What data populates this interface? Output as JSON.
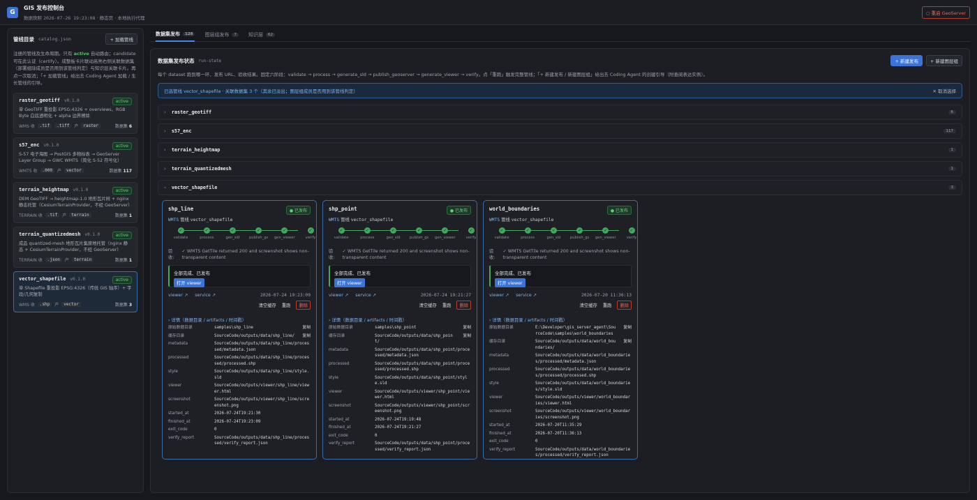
{
  "header": {
    "logo": "G",
    "title": "GIS 发布控制台",
    "subtitle_prefix": "数据快照",
    "snapshot_time": "2026-07-26 19:23:08",
    "subtitle_suffix": "· 静态页 · 本地执行代理",
    "restart": "○ 重启 GeoServer"
  },
  "sidebar": {
    "title": "管线目录",
    "file": "catalog.json",
    "add": "+ 加载管线",
    "desc_1": "注册的管线及生命周期。只有",
    "desc_active": "active",
    "desc_2": "自动路由；candidate 可在此认证（certify）。成整板卡片联动高亮右侧关联数据集（部署组除成员是否用到该管线判定）与知识层关联卡片。再点一次取消；「+ 加载管线」给出去 Coding Agent 加载 / 生长管线的引导。",
    "items": [
      {
        "name": "raster_geotiff",
        "version": "v0.1.0",
        "status": "active",
        "desc": "单 GeoTIFF 重投影 EPSG:4326 + overviews、RGB Byte 白底透明化 + alpha 边界擦除",
        "kind": "WMS 收",
        "ext1": ".tif",
        "ext2": ".tiff",
        "out_lbl": "产",
        "out": "raster",
        "count_lbl": "数据集",
        "count": "6"
      },
      {
        "name": "s57_enc",
        "version": "v0.1.0",
        "status": "active",
        "desc": "S-57 电子海图 → PostGIS 多物标表 → GeoServer Layer Group → GWC WMTS（简化 S-52 符号化）",
        "kind": "WMTS 收",
        "ext1": ".000",
        "ext2": "",
        "out_lbl": "产",
        "out": "vector",
        "count_lbl": "数据集",
        "count": "117"
      },
      {
        "name": "terrain_heightmap",
        "version": "v0.1.0",
        "status": "active",
        "desc": "DEM GeoTIFF → heightmap-1.0 地形瓦片树 + nginx 静态托管（CesiumTerrainProvider，不经 GeoServer）",
        "kind": "TERRAIN 收",
        "ext1": ".tif",
        "ext2": "",
        "out_lbl": "产",
        "out": "terrain",
        "count_lbl": "数据集",
        "count": "1"
      },
      {
        "name": "terrain_quantizedmesh",
        "version": "v0.1.0",
        "status": "active",
        "desc": "成品 quantized-mesh 地形瓦片集原地托管（nginx 静态 + CesiumTerrainProvider，不经 GeoServer）",
        "kind": "TERRAIN 收",
        "ext1": ".json",
        "ext2": "",
        "out_lbl": "产",
        "out": "terrain",
        "count_lbl": "数据集",
        "count": "1"
      },
      {
        "name": "vector_shapefile",
        "version": "v0.1.0",
        "status": "active",
        "desc": "单 Shapefile 重投影 EPSG:4326（传统 GIS 轴序）+ 字段/几何复制",
        "kind": "WMS 收",
        "ext1": ".shp",
        "ext2": "",
        "out_lbl": "产",
        "out": "vector",
        "count_lbl": "数据集",
        "count": "3"
      }
    ]
  },
  "tabs": [
    {
      "label": "数据集发布",
      "count": "128"
    },
    {
      "label": "图层组发布",
      "count": "7"
    },
    {
      "label": "知识层",
      "count": "62"
    }
  ],
  "panel": {
    "title": "数据集发布状态",
    "sub": "run-state",
    "btn_new": "+ 新建发布",
    "btn_group": "+ 新建图层组",
    "desc": "每个 dataset 跑到哪一环、发布 URL、验收结果。固定六阶段：validate → process → generate_sld → publish_geoserver → generate_viewer → verify。点「重跑」触发完整管线；「+ 新建发布 / 新建图层组」给出去 Coding Agent 的创建引导（附查阅表达实例）。",
    "alert": "已选管线 vector_shapefile · 关联数据集 3 个（其余已淡出；图层组成员是否用到该管线判定）",
    "cancel": "✕ 取消选择"
  },
  "datasets": [
    {
      "name": "raster_geotiff",
      "count": "6"
    },
    {
      "name": "s57_enc",
      "count": "117"
    },
    {
      "name": "terrain_heightmap",
      "count": "1"
    },
    {
      "name": "terrain_quantizedmesh",
      "count": "1"
    },
    {
      "name": "vector_shapefile",
      "count": "3"
    }
  ],
  "steps": [
    "validate",
    "process",
    "gen_sld",
    "publish_gs",
    "gen_viewer",
    "verify"
  ],
  "card_labels": {
    "published": "● 已发布",
    "pipeline_lbl": "管线",
    "verify_lbl": "验收:",
    "done": "全部完成、已发布",
    "open": "打开 viewer",
    "viewer": "viewer ↗",
    "service": "service ↗",
    "clear": "清空缓存",
    "rerun": "重跑",
    "delete": "删除",
    "details": "› 详情（数据目录 / artifacts / 时间戳）",
    "copy": "复制"
  },
  "cards": [
    {
      "name": "shp_line",
      "kind": "WMTS",
      "pipeline": "vector_shapefile",
      "verify": "WMTS GetTile returned 200 and screenshot shows non-transparent content",
      "ts": "2026-07-24 19:23:09",
      "details": [
        {
          "k": "原始数据目录",
          "v": "samples\\shp_line",
          "copy": true
        },
        {
          "k": "缓存目录",
          "v": "SourceCode/outputs/data/shp_line/",
          "copy": true
        },
        {
          "k": "metadata",
          "v": "SourceCode/outputs/data/shp_line/processed/metadata.json"
        },
        {
          "k": "processed",
          "v": "SourceCode/outputs/data/shp_line/processed/processed.shp"
        },
        {
          "k": "style",
          "v": "SourceCode/outputs/data/shp_line/style.sld"
        },
        {
          "k": "viewer",
          "v": "SourceCode/outputs/viewer/shp_line/viewer.html"
        },
        {
          "k": "screenshot",
          "v": "SourceCode/outputs/viewer/shp_line/screenshot.png"
        },
        {
          "k": "started_at",
          "v": "2026-07-24T19:21:30"
        },
        {
          "k": "finished_at",
          "v": "2026-07-24T19:23:09"
        },
        {
          "k": "exit_code",
          "v": "0"
        },
        {
          "k": "verify_report",
          "v": "SourceCode/outputs/data/shp_line/processed/verify_report.json"
        }
      ]
    },
    {
      "name": "shp_point",
      "kind": "WMTS",
      "pipeline": "vector_shapefile",
      "verify": "WMTS GetTile returned 200 and screenshot shows non-transparent content",
      "ts": "2026-07-24 19:21:27",
      "details": [
        {
          "k": "原始数据目录",
          "v": "samples\\shp_point",
          "copy": true
        },
        {
          "k": "缓存目录",
          "v": "SourceCode/outputs/data/shp_point/",
          "copy": true
        },
        {
          "k": "metadata",
          "v": "SourceCode/outputs/data/shp_point/processed/metadata.json"
        },
        {
          "k": "processed",
          "v": "SourceCode/outputs/data/shp_point/processed/processed.shp"
        },
        {
          "k": "style",
          "v": "SourceCode/outputs/data/shp_point/style.sld"
        },
        {
          "k": "viewer",
          "v": "SourceCode/outputs/viewer/shp_point/viewer.html"
        },
        {
          "k": "screenshot",
          "v": "SourceCode/outputs/viewer/shp_point/screenshot.png"
        },
        {
          "k": "started_at",
          "v": "2026-07-24T19:19:48"
        },
        {
          "k": "finished_at",
          "v": "2026-07-24T19:21:27"
        },
        {
          "k": "exit_code",
          "v": "0"
        },
        {
          "k": "verify_report",
          "v": "SourceCode/outputs/data/shp_point/processed/verify_report.json"
        }
      ]
    },
    {
      "name": "world_boundaries",
      "kind": "WMTS",
      "pipeline": "vector_shapefile",
      "verify": "WMTS GetTile returned 200 and screenshot shows non-transparent content",
      "ts": "2026-07-20 11:36:13",
      "details": [
        {
          "k": "原始数据目录",
          "v": "E:\\Developer\\gis_server_agent\\SourceCode\\samples\\world_boundaries",
          "copy": true
        },
        {
          "k": "缓存目录",
          "v": "SourceCode/outputs/data/world_boundaries/",
          "copy": true
        },
        {
          "k": "metadata",
          "v": "SourceCode/outputs/data/world_boundaries/processed/metadata.json"
        },
        {
          "k": "processed",
          "v": "SourceCode/outputs/data/world_boundaries/processed/processed.shp"
        },
        {
          "k": "style",
          "v": "SourceCode/outputs/data/world_boundaries/style.sld"
        },
        {
          "k": "viewer",
          "v": "SourceCode/outputs/viewer/world_boundaries/viewer.html"
        },
        {
          "k": "screenshot",
          "v": "SourceCode/outputs/viewer/world_boundaries/screenshot.png"
        },
        {
          "k": "started_at",
          "v": "2026-07-20T11:35:29"
        },
        {
          "k": "finished_at",
          "v": "2026-07-20T11:36:13"
        },
        {
          "k": "exit_code",
          "v": "0"
        },
        {
          "k": "verify_report",
          "v": "SourceCode/outputs/data/world_boundaries/processed/verify_report.json"
        }
      ]
    }
  ]
}
